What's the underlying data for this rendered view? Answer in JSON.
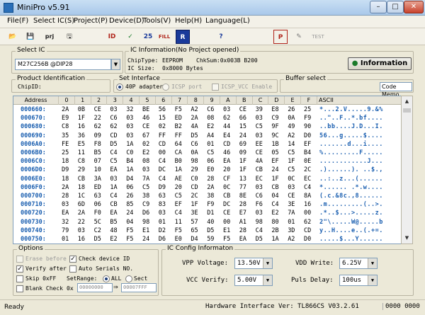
{
  "window": {
    "title": "MiniPro v5.91",
    "minimize": "–",
    "maximize": "□",
    "close": "✕"
  },
  "menu": [
    "File(F)",
    "Select IC(S)",
    "Project(P)",
    "Device(D)",
    "Tools(V)",
    "Help(H)",
    "Language(L)"
  ],
  "toolbar": [
    "open-icon",
    "save-icon",
    "load-project-icon",
    "save-project-icon",
    "read-id-icon",
    "verify-icon",
    "chip-blank-icon",
    "fill-icon",
    "read-icon",
    "help-icon",
    "program-icon",
    "edit-icon",
    "test-icon"
  ],
  "toolbar_glyphs": {
    "open-icon": "📂",
    "save-icon": "💾",
    "load-project-icon": "prj",
    "save-project-icon": "🖫",
    "read-id-icon": "ID",
    "verify-icon": "✓",
    "chip-blank-icon": "25",
    "fill-icon": "FILL",
    "read-icon": "R",
    "help-icon": "?",
    "program-icon": "P",
    "edit-icon": "✎",
    "test-icon": "TEST"
  },
  "select_ic": {
    "legend": "Select IC",
    "value": "M27C256B @DIP28"
  },
  "ic_info": {
    "legend": "IC Information(No Project opened)",
    "chip_type_label": "ChipType:",
    "chip_type": "EEPROM",
    "chksum": "ChkSum:0x003B B200",
    "ic_size_label": "IC Size:",
    "ic_size": "0x8000 Bytes",
    "information_button": "Information"
  },
  "product_id": {
    "legend": "Product Identification",
    "chip_id_label": "ChipID:"
  },
  "set_interface": {
    "legend": "Set Interface",
    "option_40p": "40P adapter",
    "option_icsp": "ICSP port",
    "option_icsp_vcc": "ICSP_VCC Enable"
  },
  "buffer_select": {
    "legend": "Buffer select",
    "value": "Code Memo"
  },
  "hex": {
    "headers": [
      "Address",
      "0",
      "1",
      "2",
      "3",
      "4",
      "5",
      "6",
      "7",
      "8",
      "9",
      "A",
      "B",
      "C",
      "D",
      "E",
      "F",
      "ASCII"
    ],
    "rows": [
      {
        "addr": "000660:",
        "bytes": [
          "2A",
          "0B",
          "CE",
          "03",
          "32",
          "BE",
          "56",
          "F5",
          "A2",
          "C6",
          "03",
          "CE",
          "39",
          "E8",
          "26",
          "25"
        ],
        "ascii": "*...2.V.....9.&%"
      },
      {
        "addr": "000670:",
        "bytes": [
          "E9",
          "1F",
          "22",
          "C6",
          "03",
          "46",
          "15",
          "ED",
          "2A",
          "08",
          "62",
          "66",
          "03",
          "C9",
          "0A",
          "F9"
        ],
        "ascii": "..\"..F..*.bf...."
      },
      {
        "addr": "000680:",
        "bytes": [
          "C8",
          "16",
          "62",
          "62",
          "03",
          "CE",
          "02",
          "B2",
          "4A",
          "E2",
          "44",
          "15",
          "C5",
          "9F",
          "49",
          "90"
        ],
        "ascii": "..bb....J.D...I."
      },
      {
        "addr": "000690:",
        "bytes": [
          "35",
          "36",
          "09",
          "CD",
          "03",
          "67",
          "FF",
          "FF",
          "D5",
          "A4",
          "E4",
          "24",
          "03",
          "9C",
          "A2",
          "D0"
        ],
        "ascii": "56...g.....$...."
      },
      {
        "addr": "0006A0:",
        "bytes": [
          "FE",
          "E5",
          "F8",
          "D5",
          "1A",
          "02",
          "CD",
          "64",
          "C6",
          "01",
          "CD",
          "69",
          "EE",
          "1B",
          "14",
          "EF"
        ],
        "ascii": ".......d...i...."
      },
      {
        "addr": "0006B0:",
        "bytes": [
          "25",
          "11",
          "B5",
          "C4",
          "C0",
          "E2",
          "00",
          "CA",
          "0A",
          "C5",
          "46",
          "09",
          "CE",
          "05",
          "C5",
          "B4"
        ],
        "ascii": "%.........F....."
      },
      {
        "addr": "0006C0:",
        "bytes": [
          "18",
          "C8",
          "07",
          "C5",
          "B4",
          "08",
          "C4",
          "B0",
          "98",
          "06",
          "EA",
          "1F",
          "4A",
          "EF",
          "1F",
          "0E"
        ],
        "ascii": "............J..."
      },
      {
        "addr": "0006D0:",
        "bytes": [
          "D9",
          "29",
          "10",
          "EA",
          "1A",
          "03",
          "DC",
          "1A",
          "29",
          "E0",
          "20",
          "1F",
          "CB",
          "24",
          "C5",
          "2C"
        ],
        "ascii": ".)......). ..$.,"
      },
      {
        "addr": "0006E0:",
        "bytes": [
          "18",
          "CB",
          "3A",
          "03",
          "D4",
          "7A",
          "C4",
          "AE",
          "C0",
          "28",
          "CF",
          "13",
          "EC",
          "1F",
          "0C",
          "EC"
        ],
        "ascii": "..:..z...(......"
      },
      {
        "addr": "0006F0:",
        "bytes": [
          "2A",
          "18",
          "ED",
          "1A",
          "06",
          "C5",
          "D9",
          "20",
          "CD",
          "2A",
          "0C",
          "77",
          "03",
          "CB",
          "03",
          "C4"
        ],
        "ascii": "*...... .*.w...."
      },
      {
        "addr": "000700:",
        "bytes": [
          "28",
          "1C",
          "63",
          "C4",
          "26",
          "38",
          "63",
          "C5",
          "2C",
          "38",
          "CB",
          "8E",
          "C6",
          "04",
          "CE",
          "8A"
        ],
        "ascii": "(.c.&8c.,8......"
      },
      {
        "addr": "000710:",
        "bytes": [
          "03",
          "6D",
          "06",
          "CB",
          "85",
          "C9",
          "83",
          "EF",
          "1F",
          "F9",
          "DC",
          "28",
          "F6",
          "C4",
          "3E",
          "16"
        ],
        "ascii": ".m.........(..>."
      },
      {
        "addr": "000720:",
        "bytes": [
          "EA",
          "2A",
          "F0",
          "EA",
          "24",
          "D6",
          "03",
          "C4",
          "3E",
          "D1",
          "CE",
          "E7",
          "03",
          "E2",
          "7A",
          "00"
        ],
        "ascii": ".*..$...>.....z."
      },
      {
        "addr": "000730:",
        "bytes": [
          "32",
          "22",
          "5C",
          "B5",
          "04",
          "98",
          "01",
          "11",
          "57",
          "40",
          "00",
          "A1",
          "98",
          "80",
          "01",
          "62"
        ],
        "ascii": "2\"\\.....W@.....b"
      },
      {
        "addr": "000740:",
        "bytes": [
          "79",
          "03",
          "C2",
          "48",
          "F5",
          "E1",
          "D2",
          "F5",
          "65",
          "D5",
          "E1",
          "28",
          "C4",
          "2B",
          "3D",
          "CD"
        ],
        "ascii": "y..H....e..(.+=."
      },
      {
        "addr": "000750:",
        "bytes": [
          "01",
          "16",
          "D5",
          "E2",
          "F5",
          "24",
          "D6",
          "E0",
          "D4",
          "59",
          "F5",
          "EA",
          "D5",
          "1A",
          "A2",
          "D0"
        ],
        "ascii": ".....$...Y......"
      }
    ]
  },
  "options": {
    "legend": "Options",
    "erase_before": "Erase before",
    "check_device_id": "Check device ID",
    "verify_after": "Verify after",
    "auto_serials": "Auto Serials NO.",
    "skip_ff": "Skip 0xFF",
    "set_range": "SetRange:",
    "range_all": "ALL",
    "range_sect": "Sect",
    "blank_check": "Blank Check",
    "ox_prefix": "0x",
    "range_start": "00000000",
    "range_end": "00007FFF"
  },
  "ic_config": {
    "legend": "IC Config Informaton",
    "vpp_label": "VPP Voltage:",
    "vpp_value": "13.50V",
    "vdd_label": "VDD Write:",
    "vdd_value": "6.25V",
    "vcc_label": "VCC Verify:",
    "vcc_value": "5.00V",
    "puls_label": "Puls Delay:",
    "puls_value": "100us"
  },
  "status": {
    "left": "Ready",
    "hardware": "Hardware Interface Ver: TL866CS V03.2.61",
    "code": "0000 0000"
  }
}
